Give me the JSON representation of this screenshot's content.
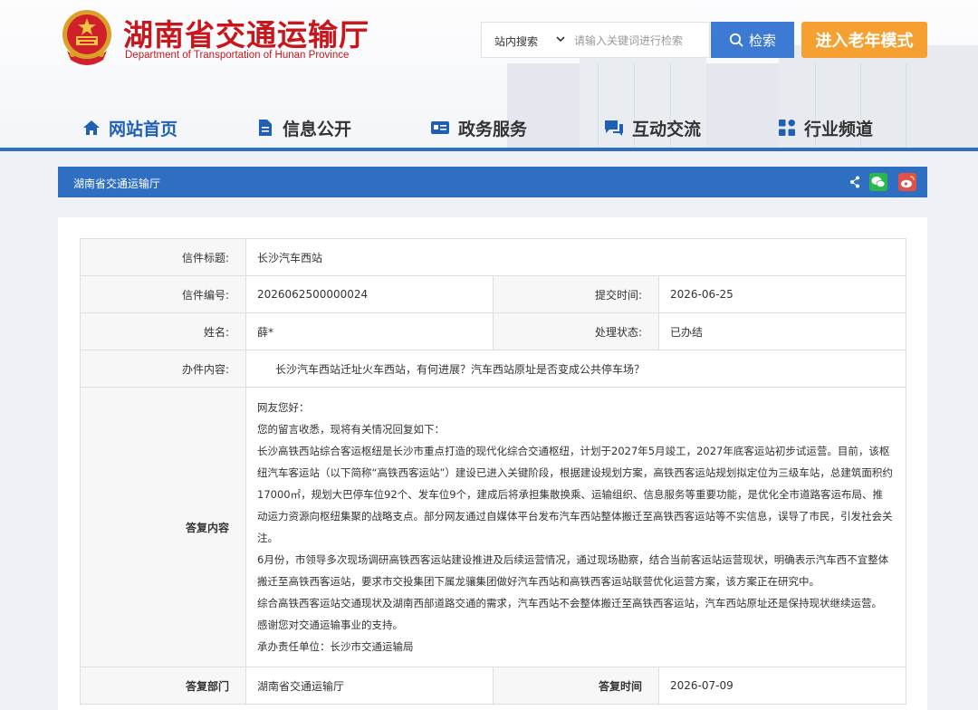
{
  "header": {
    "title": "湖南省交通运输厅",
    "subtitle": "Department of Transportation of Hunan Province",
    "search": {
      "scope": "站内搜索",
      "placeholder": "请输入关键词进行检索",
      "button": "检索"
    },
    "elder_mode": "进入老年模式"
  },
  "nav": [
    {
      "label": "网站首页",
      "icon": "home-icon"
    },
    {
      "label": "信息公开",
      "icon": "document-icon"
    },
    {
      "label": "政务服务",
      "icon": "service-card-icon"
    },
    {
      "label": "互动交流",
      "icon": "chat-icon"
    },
    {
      "label": "行业频道",
      "icon": "grid-icon"
    }
  ],
  "breadcrumb": "湖南省交通运输厅",
  "letter": {
    "title_label": "信件标题:",
    "title": "长沙汽车西站",
    "number_label": "信件编号:",
    "number": "2026062500000024",
    "submit_time_label": "提交时间:",
    "submit_time": "2026-06-25",
    "name_label": "姓名:",
    "name": "薛*",
    "status_label": "处理状态:",
    "status": "已办结",
    "content_label": "办件内容:",
    "content": "长沙汽车西站迁址火车西站，有何进展？汽车西站原址是否变成公共停车场？",
    "reply_label": "答复内容",
    "reply": [
      "网友您好：",
      "您的留言收悉，现将有关情况回复如下：",
      "长沙高铁西站综合客运枢纽是长沙市重点打造的现代化综合交通枢纽，计划于2027年5月竣工，2027年底客运站初步试运营。目前，该枢纽汽车客运站（以下简称“高铁西客运站”）建设已进入关键阶段，根据建设规划方案，高铁西客运站规划拟定位为三级车站，总建筑面积约17000㎡，规划大巴停车位92个、发车位9个，建成后将承担集散换乘、运输组织、信息服务等重要功能，是优化全市道路客运布局、推动运力资源向枢纽集聚的战略支点。部分网友通过自媒体平台发布汽车西站整体搬迁至高铁西客运站等不实信息，误导了市民，引发社会关注。",
      "6月份，市领导多次现场调研高铁西客运站建设推进及后续运营情况，通过现场勘察，结合当前客运站运营现状，明确表示汽车西不宜整体搬迁至高铁西客运站，要求市交投集团下属龙骧集团做好汽车西站和高铁西客运站联营优化运营方案，该方案正在研究中。",
      "综合高铁西客运站交通现状及湖南西部道路交通的需求，汽车西站不会整体搬迁至高铁西客运站，汽车西站原址还是保持现状继续运营。",
      "感谢您对交通运输事业的支持。",
      "承办责任单位：长沙市交通运输局"
    ],
    "dept_label": "答复部门",
    "dept": "湖南省交通运输厅",
    "reply_time_label": "答复时间",
    "reply_time": "2026-07-09"
  },
  "colors": {
    "brand_red": "#c8161d",
    "primary_blue": "#2f6fc1",
    "search_blue": "#3d7ad3",
    "elder_orange": "#f5a030"
  }
}
